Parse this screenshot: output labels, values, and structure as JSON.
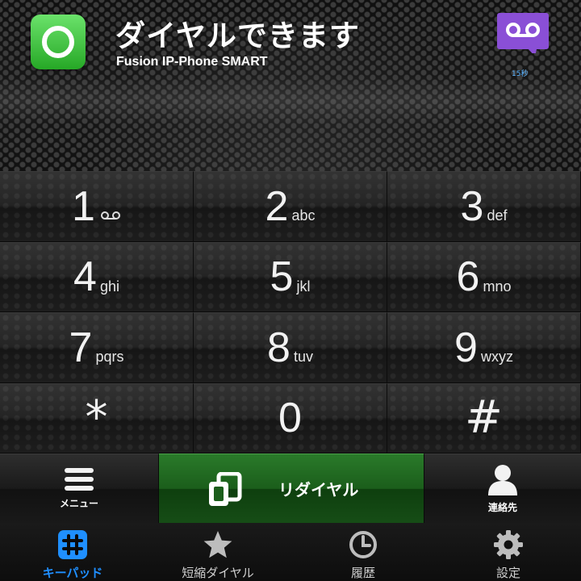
{
  "header": {
    "status_title": "ダイヤルできます",
    "app_name": "Fusion IP-Phone SMART",
    "voicemail_count": "15秒",
    "icons": {
      "status": "green-ring-icon",
      "voicemail": "voicemail-icon"
    }
  },
  "keypad": {
    "keys": [
      {
        "digit": "1",
        "letters": ""
      },
      {
        "digit": "2",
        "letters": "abc"
      },
      {
        "digit": "3",
        "letters": "def"
      },
      {
        "digit": "4",
        "letters": "ghi"
      },
      {
        "digit": "5",
        "letters": "jkl"
      },
      {
        "digit": "6",
        "letters": "mno"
      },
      {
        "digit": "7",
        "letters": "pqrs"
      },
      {
        "digit": "8",
        "letters": "tuv"
      },
      {
        "digit": "9",
        "letters": "wxyz"
      },
      {
        "digit": "*",
        "letters": ""
      },
      {
        "digit": "0",
        "letters": ""
      },
      {
        "digit": "#",
        "letters": ""
      }
    ]
  },
  "actions": {
    "menu_label": "メニュー",
    "redial_label": "リダイヤル",
    "contacts_label": "連絡先"
  },
  "tabs": [
    {
      "label": "キーパッド",
      "icon": "keypad-icon",
      "active": true
    },
    {
      "label": "短縮ダイヤル",
      "icon": "star-icon",
      "active": false
    },
    {
      "label": "履歴",
      "icon": "clock-icon",
      "active": false
    },
    {
      "label": "設定",
      "icon": "gear-icon",
      "active": false
    }
  ],
  "colors": {
    "status_green": "#3fc43f",
    "voicemail_purple": "#8a4fd6",
    "redial_green": "#1b5e1b",
    "active_tab_blue": "#1f8fff"
  }
}
